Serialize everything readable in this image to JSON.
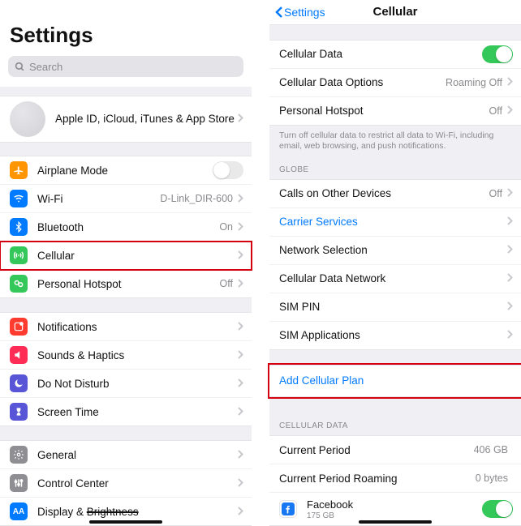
{
  "left": {
    "title": "Settings",
    "searchPlaceholder": "Search",
    "appleId": "Apple ID, iCloud, iTunes & App Store",
    "rows": {
      "airplane": "Airplane Mode",
      "wifi": "Wi-Fi",
      "wifiValue": "D-Link_DIR-600",
      "bt": "Bluetooth",
      "btValue": "On",
      "cellular": "Cellular",
      "hotspot": "Personal Hotspot",
      "hotspotValue": "Off",
      "notif": "Notifications",
      "sounds": "Sounds & Haptics",
      "dnd": "Do Not Disturb",
      "screentime": "Screen Time",
      "general": "General",
      "cc": "Control Center",
      "display": "Display & Brightness"
    }
  },
  "right": {
    "back": "Settings",
    "title": "Cellular",
    "rows": {
      "data": "Cellular Data",
      "options": "Cellular Data Options",
      "optionsValue": "Roaming Off",
      "hotspot": "Personal Hotspot",
      "hotspotValue": "Off",
      "note": "Turn off cellular data to restrict all data to Wi-Fi, including email, web browsing, and push notifications.",
      "globeHeader": "GLOBE",
      "calls": "Calls on Other Devices",
      "callsValue": "Off",
      "carrier": "Carrier Services",
      "network": "Network Selection",
      "dataNetwork": "Cellular Data Network",
      "simpin": "SIM PIN",
      "simapps": "SIM Applications",
      "addplan": "Add Cellular Plan",
      "cdHeader": "CELLULAR DATA",
      "period": "Current Period",
      "periodValue": "406 GB",
      "roaming": "Current Period Roaming",
      "roamingValue": "0 bytes",
      "fb": "Facebook",
      "fbValue": "175 GB"
    }
  }
}
